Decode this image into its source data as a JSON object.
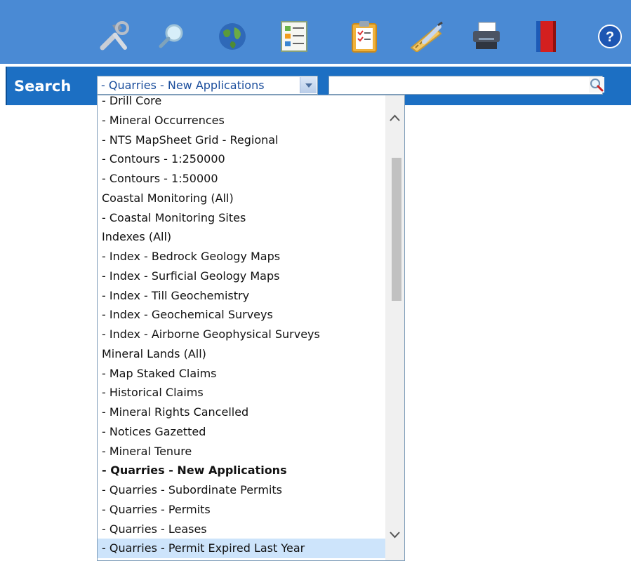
{
  "toolbar": {
    "tools": [
      {
        "name": "tools-icon"
      },
      {
        "name": "magnifier-icon"
      },
      {
        "name": "globe-icon"
      },
      {
        "name": "legend-icon"
      },
      {
        "name": "clipboard-icon"
      },
      {
        "name": "measure-icon"
      },
      {
        "name": "printer-icon"
      },
      {
        "name": "book-icon"
      },
      {
        "name": "help-icon",
        "text": "?"
      }
    ]
  },
  "search": {
    "label": "Search",
    "selected_layer": "- Quarries - New Applications",
    "query": ""
  },
  "dropdown": {
    "items": [
      {
        "label": "- Drill Core"
      },
      {
        "label": "- Mineral Occurrences"
      },
      {
        "label": "- NTS MapSheet Grid - Regional"
      },
      {
        "label": "- Contours - 1:250000"
      },
      {
        "label": "- Contours - 1:50000"
      },
      {
        "label": "Coastal Monitoring (All)"
      },
      {
        "label": "- Coastal Monitoring Sites"
      },
      {
        "label": "Indexes (All)"
      },
      {
        "label": "- Index - Bedrock Geology Maps"
      },
      {
        "label": "- Index - Surficial Geology Maps"
      },
      {
        "label": "- Index - Till Geochemistry"
      },
      {
        "label": "- Index - Geochemical Surveys"
      },
      {
        "label": "- Index - Airborne Geophysical Surveys"
      },
      {
        "label": "Mineral Lands (All)"
      },
      {
        "label": "- Map Staked Claims"
      },
      {
        "label": "- Historical Claims"
      },
      {
        "label": "- Mineral Rights Cancelled"
      },
      {
        "label": "- Notices Gazetted"
      },
      {
        "label": "- Mineral Tenure"
      },
      {
        "label": "- Quarries - New Applications",
        "selected": true
      },
      {
        "label": "- Quarries - Subordinate Permits"
      },
      {
        "label": "- Quarries - Permits"
      },
      {
        "label": "- Quarries - Leases"
      },
      {
        "label": "- Quarries - Permit Expired Last Year",
        "hover": true
      }
    ]
  },
  "colors": {
    "toolbar_bg": "#4a8ad4",
    "searchbar_bg": "#1c6fc3",
    "hover_bg": "#cde4fb"
  }
}
